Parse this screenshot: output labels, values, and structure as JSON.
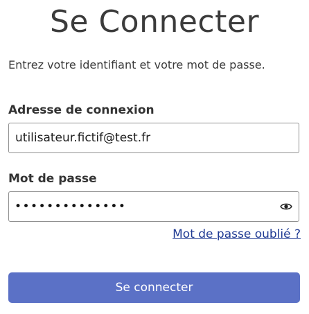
{
  "title": "Se Connecter",
  "intro": "Entrez votre identifiant et votre mot de passe.",
  "email": {
    "label": "Adresse de connexion",
    "value": "utilisateur.fictif@test.fr"
  },
  "password": {
    "label": "Mot de passe",
    "masked_value": "••••••••••••••",
    "toggle_icon": "eye-icon"
  },
  "forgot_link": "Mot de passe oublié ?",
  "submit_label": "Se connecter",
  "colors": {
    "button_background": "#5b71c6",
    "link": "#1f3a93",
    "input_border": "#8f8f8f"
  }
}
